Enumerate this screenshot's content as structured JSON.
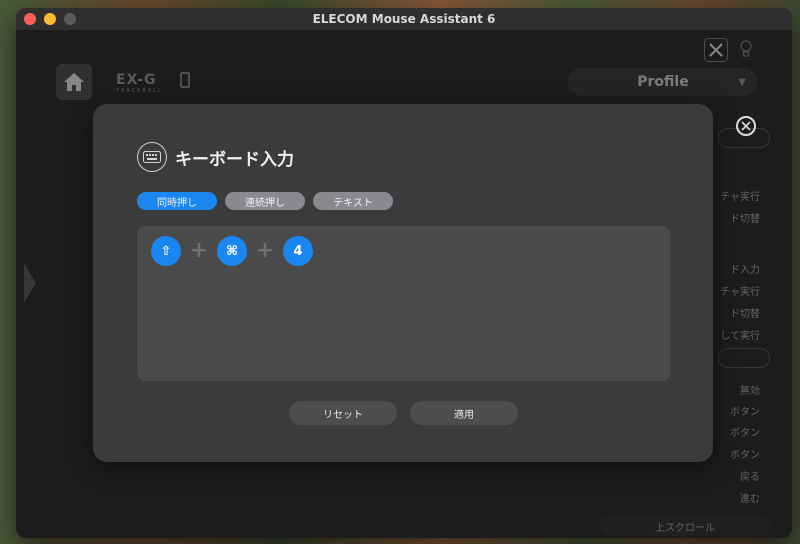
{
  "window": {
    "title": "ELECOM Mouse Assistant 6"
  },
  "header": {
    "brand": "EX-G",
    "brand_sub": "TRACKBALL",
    "profile_label": "Profile"
  },
  "side_panel": {
    "items": [
      "チャ実行",
      "ド切替",
      "ド入力",
      "チャ実行",
      "ド切替",
      "して実行",
      "無効",
      "ボタン",
      "ボタン",
      "ボタン",
      "戻る",
      "進む"
    ],
    "bottom": "上スクロール"
  },
  "dialog": {
    "title": "キーボード入力",
    "tabs": [
      {
        "label": "同時押し",
        "active": true
      },
      {
        "label": "連続押し",
        "active": false
      },
      {
        "label": "テキスト",
        "active": false
      }
    ],
    "keys": [
      {
        "symbol": "⇧",
        "name": "shift"
      },
      {
        "symbol": "⌘",
        "name": "command"
      },
      {
        "symbol": "4",
        "name": "4"
      }
    ],
    "plus": "+",
    "reset_label": "リセット",
    "apply_label": "適用"
  },
  "colors": {
    "accent": "#1a86f0",
    "dialog_bg": "#3b3b3b",
    "panel_bg": "#4a4a4a"
  }
}
